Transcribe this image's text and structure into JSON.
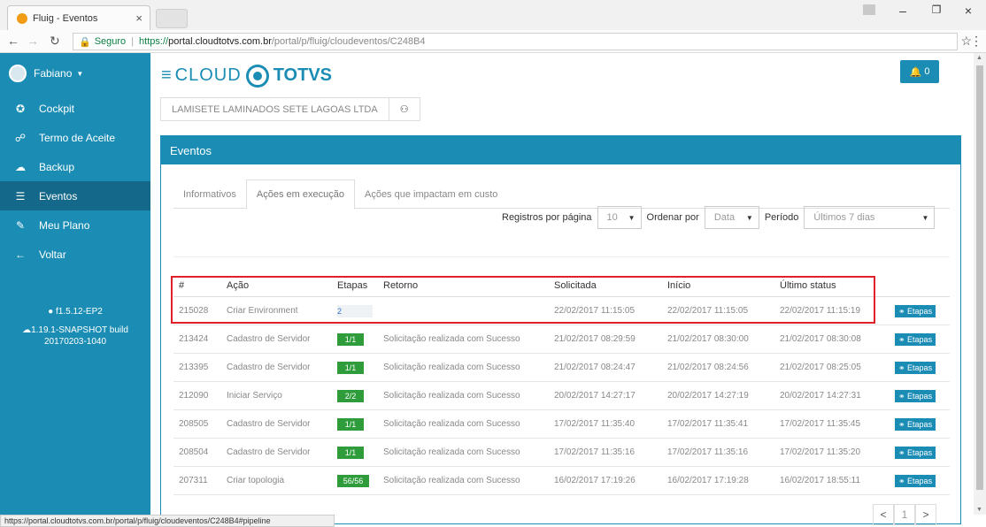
{
  "browser": {
    "tab_title": "Fluig - Eventos",
    "tab_close": "×",
    "address_secure": "Seguro",
    "address_https": "https://",
    "address_domain": "portal.cloudtotvs.com.br",
    "address_path": "/portal/p/fluig/cloudeventos/C248B4",
    "status_url": "https://portal.cloudtotvs.com.br/portal/p/fluig/cloudeventos/C248B4#pipeline"
  },
  "sidebar": {
    "user": "Fabiano",
    "items": [
      {
        "label": "Cockpit",
        "icon": "dashboard-icon",
        "glyph": "✪"
      },
      {
        "label": "Termo de Aceite",
        "icon": "handshake-icon",
        "glyph": "☍"
      },
      {
        "label": "Backup",
        "icon": "cloud-icon",
        "glyph": "☁"
      },
      {
        "label": "Eventos",
        "icon": "list-icon",
        "glyph": "☰"
      },
      {
        "label": "Meu Plano",
        "icon": "edit-icon",
        "glyph": "✎"
      },
      {
        "label": "Voltar",
        "icon": "arrow-left-icon",
        "glyph": "←"
      }
    ],
    "version1": "f1.5.12-EP2",
    "version2": "1.19.1-SNAPSHOT build",
    "version3": "20170203-1040"
  },
  "header": {
    "logo_cloud": "CLOUD",
    "logo_totvs": "TOTVS",
    "notifications": "0"
  },
  "company": {
    "name": "LAMISETE LAMINADOS SETE LAGOAS LTDA"
  },
  "panel": {
    "title": "Eventos",
    "tabs": [
      "Informativos",
      "Ações em execução",
      "Ações que impactam em custo"
    ]
  },
  "filters": {
    "per_page_label": "Registros por página",
    "per_page_value": "10",
    "order_label": "Ordenar por",
    "order_value": "Data",
    "period_label": "Período",
    "period_value": "Últimos 7 dias"
  },
  "table": {
    "headers": [
      "#",
      "Ação",
      "Etapas",
      "Retorno",
      "Solicitada",
      "Início",
      "Último status"
    ],
    "button_label": "Etapas",
    "rows": [
      {
        "id": "215028",
        "acao": "Criar Environment",
        "etapas": "2",
        "retorno": "",
        "solicitada": "22/02/2017 11:15:05",
        "inicio": "22/02/2017 11:15:05",
        "status": "22/02/2017 11:15:19"
      },
      {
        "id": "213424",
        "acao": "Cadastro de Servidor",
        "etapas": "1/1",
        "retorno": "Solicitação realizada com Sucesso",
        "solicitada": "21/02/2017 08:29:59",
        "inicio": "21/02/2017 08:30:00",
        "status": "21/02/2017 08:30:08"
      },
      {
        "id": "213395",
        "acao": "Cadastro de Servidor",
        "etapas": "1/1",
        "retorno": "Solicitação realizada com Sucesso",
        "solicitada": "21/02/2017 08:24:47",
        "inicio": "21/02/2017 08:24:56",
        "status": "21/02/2017 08:25:05"
      },
      {
        "id": "212090",
        "acao": "Iniciar Serviço",
        "etapas": "2/2",
        "retorno": "Solicitação realizada com Sucesso",
        "solicitada": "20/02/2017 14:27:17",
        "inicio": "20/02/2017 14:27:19",
        "status": "20/02/2017 14:27:31"
      },
      {
        "id": "208505",
        "acao": "Cadastro de Servidor",
        "etapas": "1/1",
        "retorno": "Solicitação realizada com Sucesso",
        "solicitada": "17/02/2017 11:35:40",
        "inicio": "17/02/2017 11:35:41",
        "status": "17/02/2017 11:35:45"
      },
      {
        "id": "208504",
        "acao": "Cadastro de Servidor",
        "etapas": "1/1",
        "retorno": "Solicitação realizada com Sucesso",
        "solicitada": "17/02/2017 11:35:16",
        "inicio": "17/02/2017 11:35:16",
        "status": "17/02/2017 11:35:20"
      },
      {
        "id": "207311",
        "acao": "Criar topologia",
        "etapas": "56/56",
        "retorno": "Solicitação realizada com Sucesso",
        "solicitada": "16/02/2017 17:19:26",
        "inicio": "16/02/2017 17:19:28",
        "status": "16/02/2017 18:55:11"
      }
    ]
  },
  "pager": {
    "prev": "<",
    "page": "1",
    "next": ">"
  },
  "colors": {
    "accent": "#1b8db4",
    "success": "#2e9c3a",
    "highlight": "#e0202a"
  }
}
